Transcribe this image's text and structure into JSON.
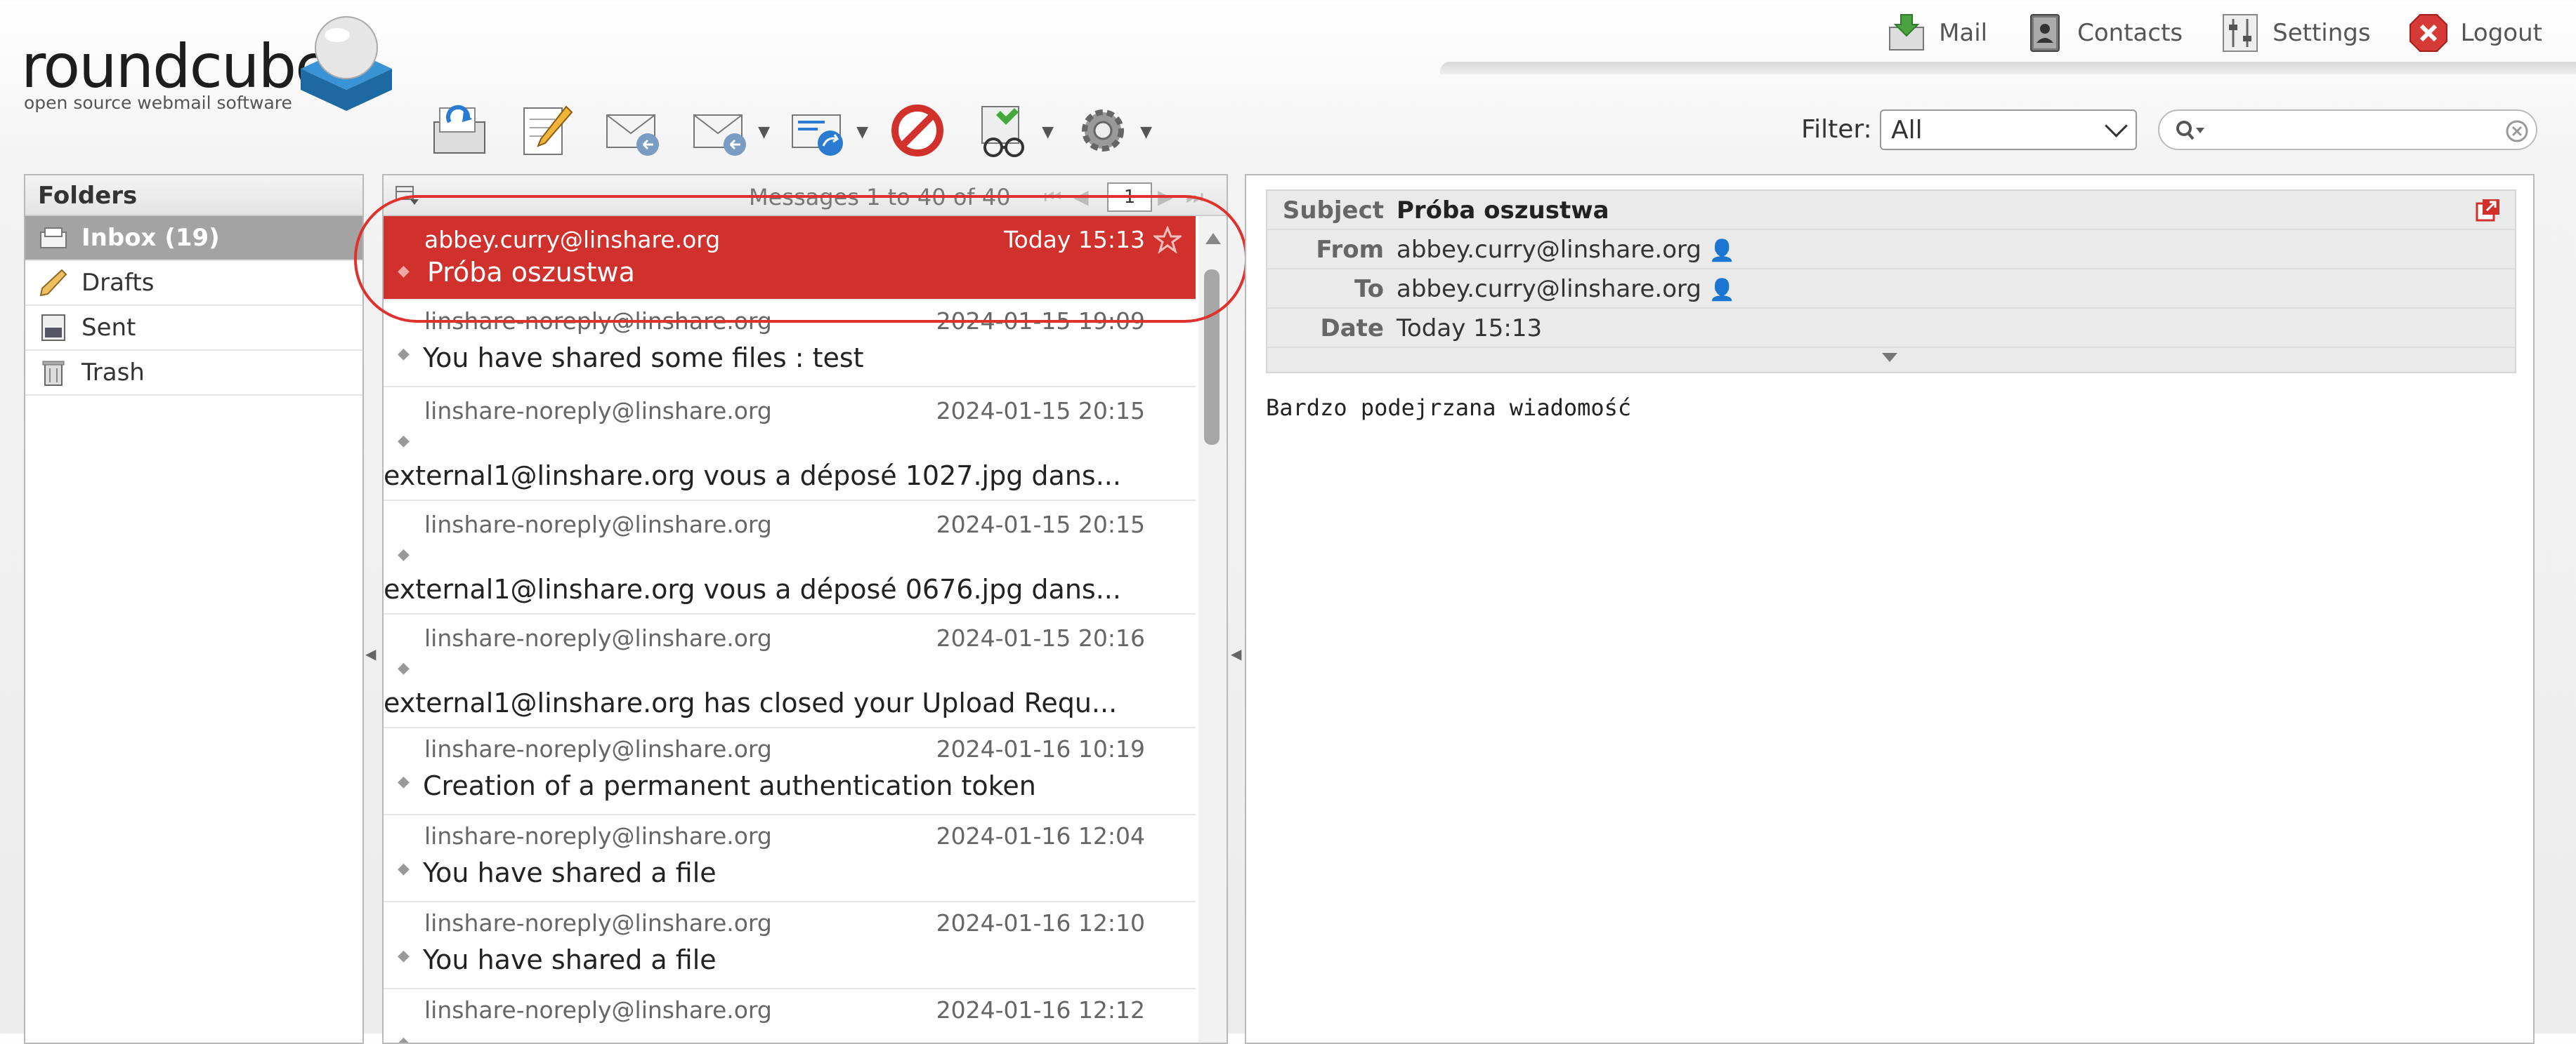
{
  "logo": {
    "word": "roundcube",
    "tagline": "open source webmail software"
  },
  "nav": [
    {
      "label": "Mail",
      "icon": "mail-download-icon"
    },
    {
      "label": "Contacts",
      "icon": "contacts-book-icon"
    },
    {
      "label": "Settings",
      "icon": "settings-sliders-icon"
    },
    {
      "label": "Logout",
      "icon": "logout-x-icon"
    }
  ],
  "toolbar": {
    "buttons": [
      "check-mail-icon",
      "compose-icon",
      "reply-icon",
      "reply-all-icon",
      "forward-icon",
      "delete-icon",
      "mark-icon",
      "more-gear-icon"
    ]
  },
  "filter": {
    "label": "Filter:",
    "selected": "All"
  },
  "search": {
    "placeholder": ""
  },
  "folders": {
    "header": "Folders",
    "items": [
      {
        "label": "Inbox (19)",
        "icon": "inbox-icon",
        "selected": true
      },
      {
        "label": "Drafts",
        "icon": "pencil-icon",
        "selected": false
      },
      {
        "label": "Sent",
        "icon": "sent-icon",
        "selected": false
      },
      {
        "label": "Trash",
        "icon": "trash-icon",
        "selected": false
      }
    ]
  },
  "messagelist": {
    "count_text": "Messages 1 to 40 of 40",
    "page": "1",
    "rows": [
      {
        "from": "abbey.curry@linshare.org",
        "date": "Today 15:13",
        "subject": "Próba oszustwa",
        "selected": true,
        "layout": "two"
      },
      {
        "from": "linshare-noreply@linshare.org",
        "date": "2024-01-15 19:09",
        "subject": "You have shared some files : test",
        "layout": "two"
      },
      {
        "from": "linshare-noreply@linshare.org",
        "date": "2024-01-15 20:15",
        "subject": "external1@linshare.org vous a déposé 1027.jpg dans...",
        "layout": "three"
      },
      {
        "from": "linshare-noreply@linshare.org",
        "date": "2024-01-15 20:15",
        "subject": "external1@linshare.org vous a déposé 0676.jpg dans...",
        "layout": "three"
      },
      {
        "from": "linshare-noreply@linshare.org",
        "date": "2024-01-15 20:16",
        "subject": "external1@linshare.org has closed your Upload Requ...",
        "layout": "three"
      },
      {
        "from": "linshare-noreply@linshare.org",
        "date": "2024-01-16 10:19",
        "subject": "Creation of a permanent authentication token",
        "layout": "two"
      },
      {
        "from": "linshare-noreply@linshare.org",
        "date": "2024-01-16 12:04",
        "subject": "You have shared a file",
        "layout": "two"
      },
      {
        "from": "linshare-noreply@linshare.org",
        "date": "2024-01-16 12:10",
        "subject": "You have shared a file",
        "layout": "two"
      },
      {
        "from": "linshare-noreply@linshare.org",
        "date": "2024-01-16 12:12",
        "subject": "",
        "layout": "two"
      }
    ]
  },
  "preview": {
    "subject_label": "Subject",
    "subject": "Próba oszustwa",
    "from_label": "From",
    "from": "abbey.curry@linshare.org",
    "to_label": "To",
    "to": "abbey.curry@linshare.org",
    "date_label": "Date",
    "date": "Today 15:13",
    "body": "Bardzo podejrzana wiadomość"
  },
  "colors": {
    "selected_row": "#d0312d",
    "highlight_ring": "#e0312c",
    "folder_selected": "#a3a3a3"
  }
}
